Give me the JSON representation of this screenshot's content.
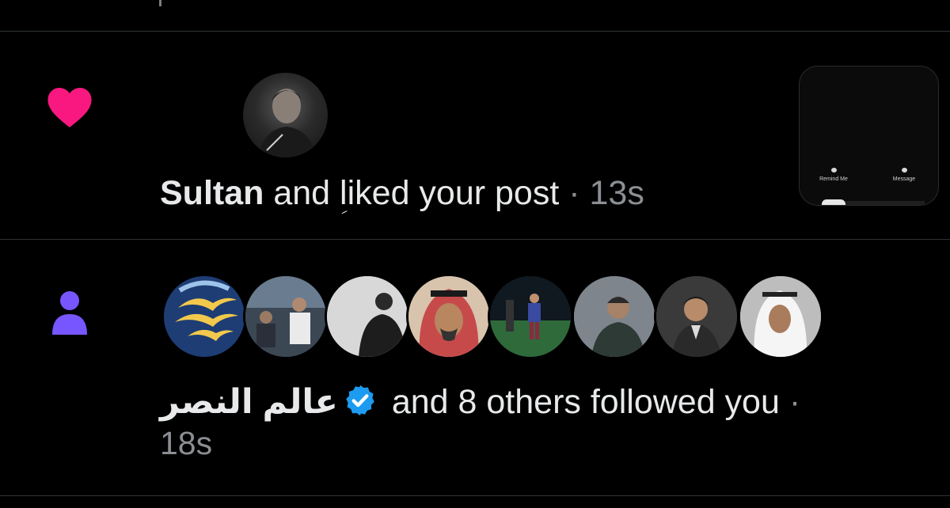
{
  "notifications": [
    {
      "type": "like",
      "icon": "heart-icon",
      "icon_color": "#f91880",
      "actor_name": "Sultan",
      "action_text": " and ؚliked your post",
      "separator": " · ",
      "time": "13s",
      "thumbnail": {
        "remind_label": "Remind Me",
        "message_label": "Message"
      }
    },
    {
      "type": "follow",
      "icon": "person-icon",
      "icon_color": "#7856ff",
      "actor_name": "عالم النصر",
      "verified": true,
      "verified_color": "#1d9bf0",
      "action_text": " and 8 others followed you ",
      "separator": "·",
      "time": "18s",
      "follower_count_shown": 8
    }
  ]
}
